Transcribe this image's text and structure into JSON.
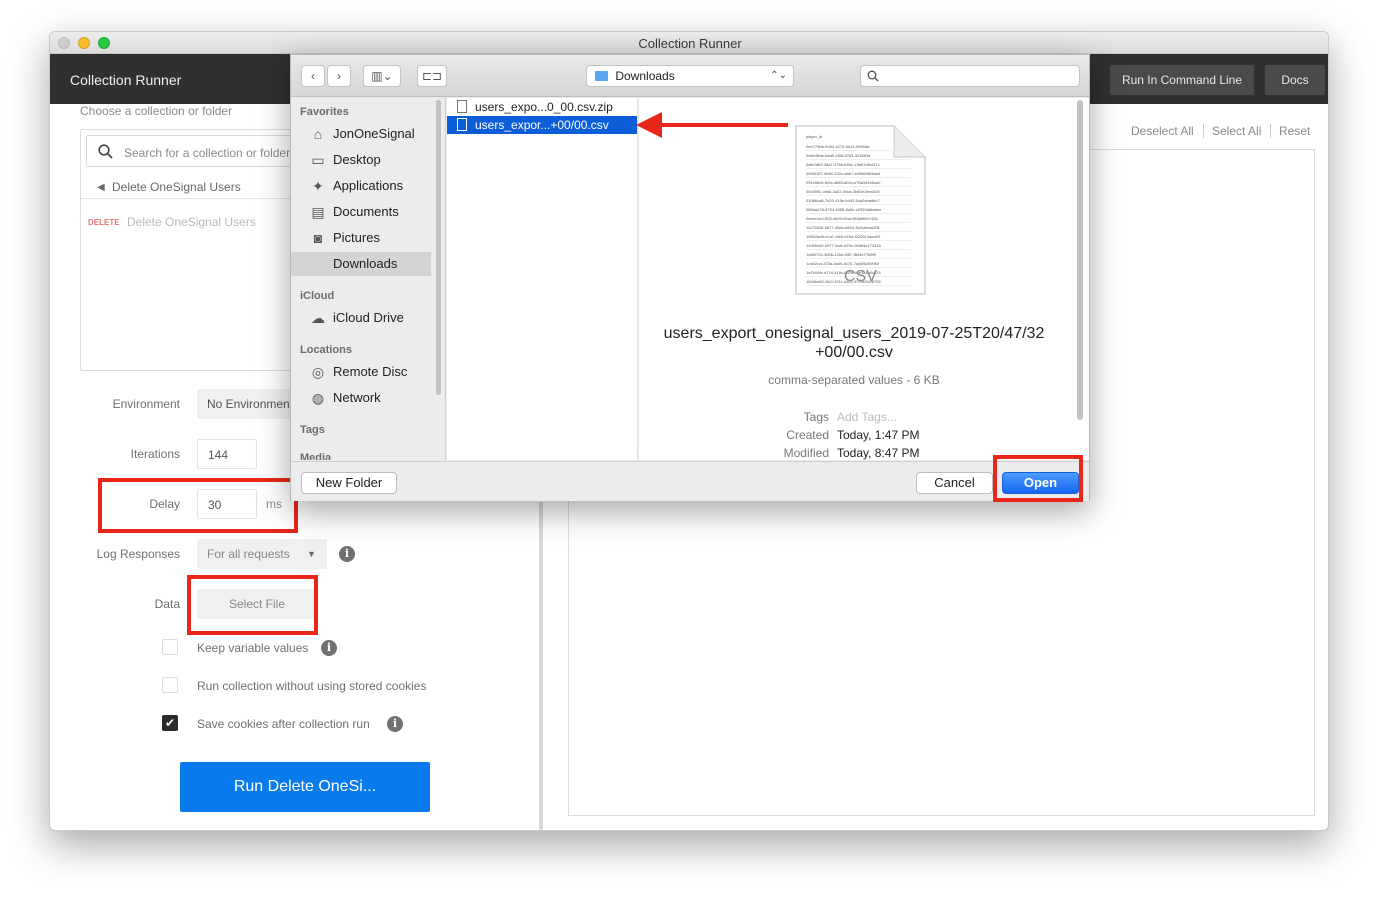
{
  "window": {
    "title": "Collection Runner"
  },
  "header": {
    "title": "Collection Runner",
    "run_cli_label": "Run In Command Line",
    "docs_label": "Docs"
  },
  "left": {
    "choose_label": "Choose a collection or folder",
    "search_placeholder": "Search for a collection or folder",
    "breadcrumb": "Delete OneSignal Users",
    "request_method": "DELETE",
    "request_name": "Delete OneSignal Users",
    "environment_label": "Environment",
    "environment_value": "No Environment",
    "iterations_label": "Iterations",
    "iterations_value": "144",
    "delay_label": "Delay",
    "delay_value": "30",
    "delay_unit": "ms",
    "log_label": "Log Responses",
    "log_value": "For all requests",
    "data_label": "Data",
    "select_file_label": "Select File",
    "keep_vars_label": "Keep variable values",
    "no_cookies_label": "Run collection without using stored cookies",
    "save_cookies_label": "Save cookies after collection run",
    "save_cookies_checked": true,
    "run_button_label": "Run Delete OneSi..."
  },
  "right": {
    "deselect_all": "Deselect All",
    "select_all": "Select All",
    "reset": "Reset"
  },
  "dialog": {
    "location": "Downloads",
    "search_placeholder": "",
    "sidebar": {
      "favorites_head": "Favorites",
      "favorites": [
        {
          "label": "JonOneSignal",
          "icon": "home-icon"
        },
        {
          "label": "Desktop",
          "icon": "desktop-icon"
        },
        {
          "label": "Applications",
          "icon": "applications-icon"
        },
        {
          "label": "Documents",
          "icon": "documents-icon"
        },
        {
          "label": "Pictures",
          "icon": "pictures-icon"
        },
        {
          "label": "Downloads",
          "icon": "downloads-icon"
        }
      ],
      "icloud_head": "iCloud",
      "icloud": [
        {
          "label": "iCloud Drive",
          "icon": "cloud-icon"
        }
      ],
      "locations_head": "Locations",
      "locations": [
        {
          "label": "Remote Disc",
          "icon": "disc-icon"
        },
        {
          "label": "Network",
          "icon": "globe-icon"
        }
      ],
      "tags_head": "Tags",
      "media_head": "Media"
    },
    "files": [
      {
        "name": "users_expo...0_00.csv.zip",
        "selected": false
      },
      {
        "name": "users_expor...+00/00.csv",
        "selected": true
      }
    ],
    "preview": {
      "filename": "users_export_onesignal_users_2019-07-25T20/47/32+00/00.csv",
      "filename_line1": "users_export_onesignal_users_2019-07-25T20/47/32",
      "filename_line2": "+00/00.csv",
      "kind": "comma-separated values - 6 KB",
      "tags_label": "Tags",
      "tags_value": "Add Tags...",
      "created_label": "Created",
      "created_value": "Today, 1:47 PM",
      "modified_label": "Modified",
      "modified_value": "Today, 8:47 PM",
      "doc_badge": "CSV",
      "doc_header": "player_id",
      "doc_rows": [
        "0eb779bb-5d54-4275-8d13-0096da",
        "0d6e35de-bad5-4f08-87d3-321883a",
        "0dfc2d03-35a7-476b-b90c-13b97df4437c",
        "0f455187-0b82-432c-a8b7-64366f963aa4",
        "091c5bc9-fb2a-4b55-a02c-e76a342e5ca2",
        "04c05ff2-cbb0-4a22-b9ca-3b80e1bea025",
        "01086ca8-7b20-415e-b443-5ca2deadbc7",
        "089aa228-8794-4385-8a5e-c0353d6fa6ee",
        "0beec1e3-f53f-4003-b5ce-f8369f847426",
        "11c75540-5677-46da-b594-3b2cbeaa2f3f",
        "19692ad9-b2a7-4fe9-b15d-f220913aa429",
        "14350c64-0977-4afc-b29e-05db5c173318",
        "1d6f072e-3d06-42bb-83f7-f843e77b5fff",
        "1cdb2ccc-f23a-4a49-8c76-7a48f6209064",
        "1a7b04fe-d77d-419c-8d2a-c5e3a4b0c576",
        "1634ba52-0fc0-4211-a1b2-97c9e2d56799"
      ]
    },
    "new_folder_label": "New Folder",
    "cancel_label": "Cancel",
    "open_label": "Open"
  },
  "colors": {
    "header_bg": "#303030",
    "run_button": "#097bed",
    "highlight": "#e8271a",
    "selection": "#0b5ed7"
  }
}
